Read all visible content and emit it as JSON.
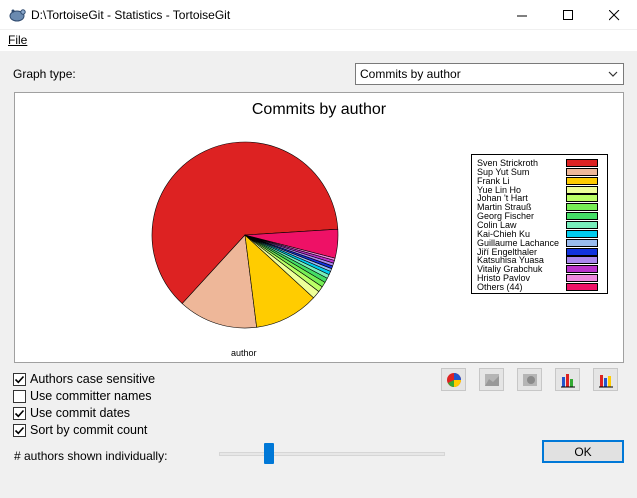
{
  "window": {
    "title": "D:\\TortoiseGit - Statistics - TortoiseGit",
    "app_icon": "tortoisegit-icon"
  },
  "menu": {
    "file": "File"
  },
  "graph_type": {
    "label": "Graph type:",
    "selected": "Commits by author"
  },
  "chart_data": {
    "type": "pie",
    "title": "Commits by author",
    "xlabel": "author",
    "legend_position": "right",
    "slices": [
      {
        "name": "Sven Strickroth",
        "value": 62.2,
        "color": "#dd2222"
      },
      {
        "name": "Sup Yut Sum",
        "value": 13.8,
        "color": "#eeb799"
      },
      {
        "name": "Frank Li",
        "value": 11.2,
        "color": "#ffcc00"
      },
      {
        "name": "Yue Lin Ho",
        "value": 1.4,
        "color": "#eeff99"
      },
      {
        "name": "Johan 't Hart",
        "value": 1.0,
        "color": "#bbff66"
      },
      {
        "name": "Martin Strauß",
        "value": 0.9,
        "color": "#77ee55"
      },
      {
        "name": "Georg Fischer",
        "value": 0.8,
        "color": "#44dd66"
      },
      {
        "name": "Colin Law",
        "value": 0.7,
        "color": "#77eebb"
      },
      {
        "name": "Kai-Chieh Ku",
        "value": 0.6,
        "color": "#00ccee"
      },
      {
        "name": "Guillaume Lachance",
        "value": 0.5,
        "color": "#99bbee"
      },
      {
        "name": "Jiří Engelthaler",
        "value": 0.5,
        "color": "#1133dd"
      },
      {
        "name": "Katsuhisa Yuasa",
        "value": 0.5,
        "color": "#aa88ee"
      },
      {
        "name": "Vitaliy Grabchuk",
        "value": 0.5,
        "color": "#bb33cc"
      },
      {
        "name": "Hristo Pavlov",
        "value": 0.4,
        "color": "#ee88dd"
      },
      {
        "name": "Others (44)",
        "value": 5.0,
        "color": "#ee1166"
      }
    ]
  },
  "options": [
    {
      "label": "Authors case sensitive",
      "checked": true
    },
    {
      "label": "Use committer names",
      "checked": false
    },
    {
      "label": "Use commit dates",
      "checked": true
    },
    {
      "label": "Sort by commit count",
      "checked": true
    }
  ],
  "authors_shown": {
    "label": "# authors shown individually:",
    "value_fraction": 0.22
  },
  "ok_button": "OK"
}
